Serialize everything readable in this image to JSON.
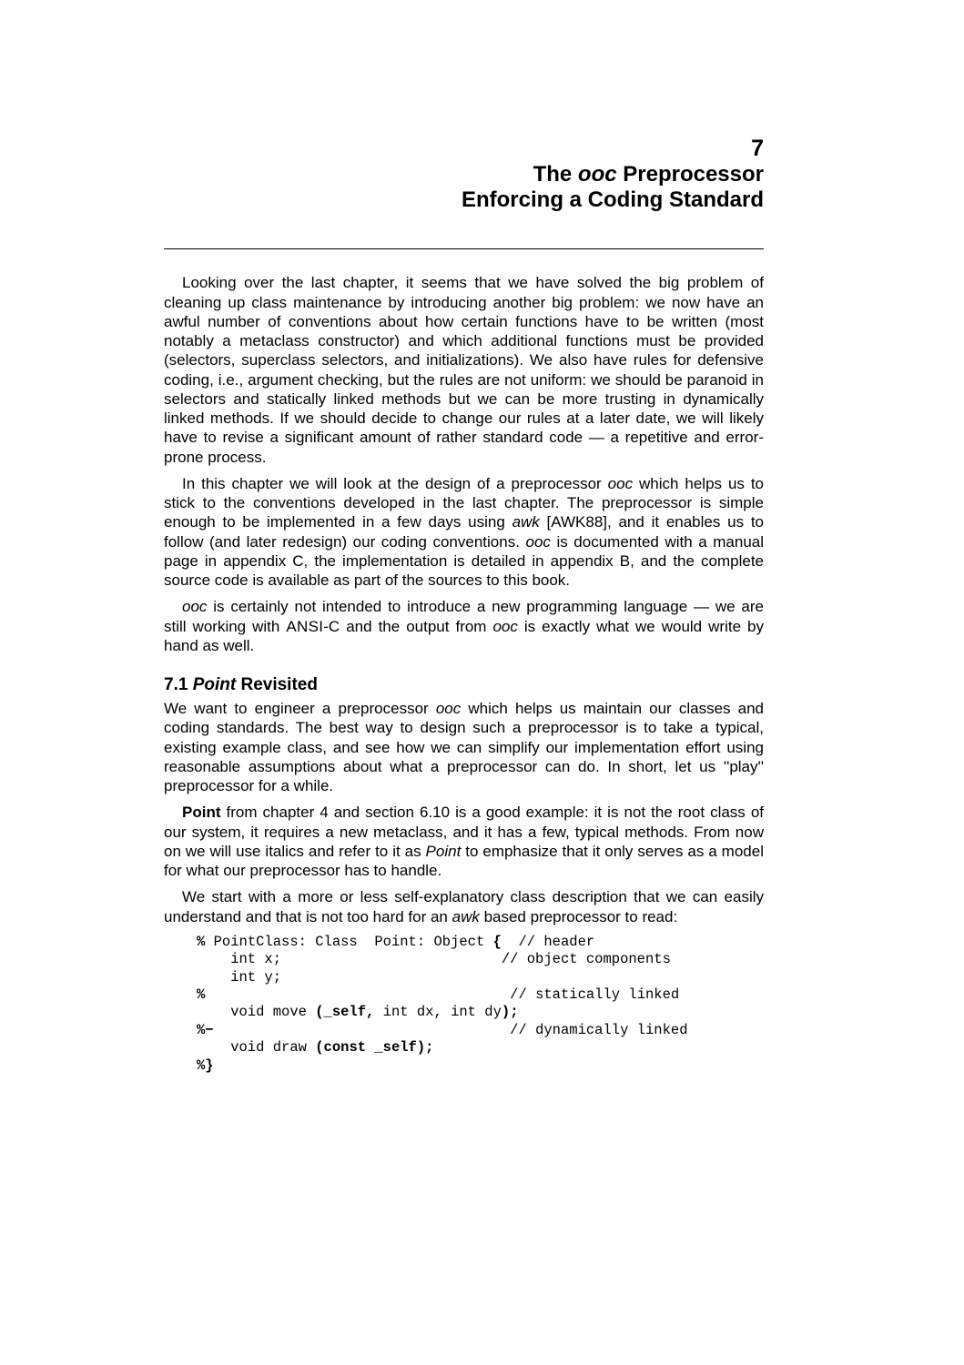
{
  "chapter": {
    "number": "7",
    "title_line1_pre": "The ",
    "title_line1_ooc": "ooc",
    "title_line1_post": " Preprocessor",
    "title_line2": "Enforcing a Coding Standard"
  },
  "para1": {
    "t1": "Looking over the last chapter, it seems that we have solved the big problem of cleaning up class maintenance by introducing another big problem: we now have an awful number of conventions about how certain functions have to be written (most notably a metaclass constructor) and which additional functions must be provided (selectors, superclass selectors, and initializations). We also have rules for defensive coding, i.e., argument checking, but the rules are not uniform: we should be paranoid in selectors and statically linked methods but we can be more trusting in dynamically linked methods. If we should decide to change our rules at a later date, we will likely have to revise a significant amount of rather standard code — a repetitive and error-prone process."
  },
  "para2": {
    "t1": "In this chapter we will look at the design of a preprocessor ",
    "ooc1": "ooc",
    "t2": " which helps us to stick to the conventions developed in the last chapter. The preprocessor is simple enough to be implemented in a few days using ",
    "awk": "awk",
    "t3": " [AWK88], and it enables us to follow (and later redesign) our coding conventions. ",
    "ooc2": "ooc",
    "t4": " is documented with a manual page in appendix C, the implementation is detailed in appendix B, and the complete source code is available as part of the sources to this book."
  },
  "para3": {
    "ooc1": "ooc",
    "t1": " is certainly not intended to introduce a new programming language — we are still working with ",
    "ansi": "ANSI",
    "t2": "-C and the output from ",
    "ooc2": "ooc",
    "t3": " is exactly what we would write by hand as well."
  },
  "section": {
    "num": "7.1 ",
    "pointword": "Point",
    "rest": " Revisited"
  },
  "para4": {
    "t1": "We want to engineer a preprocessor ",
    "ooc1": "ooc",
    "t2": " which helps us maintain our classes and coding standards. The best way to design such a preprocessor is to take a typical, existing example class, and see how we can simplify our implementation effort using reasonable assumptions about what a preprocessor can do. In short, let us ''play'' preprocessor for a while."
  },
  "para5": {
    "Point1": "Point",
    "t1": " from chapter 4 and section 6.10 is a good example: it is not the root class of our system, it requires a new metaclass, and it has a few, typical methods. From now on we will use italics and refer to it as ",
    "Point2": "Point",
    "t2": " to emphasize that it only serves as a model for what our preprocessor has to handle."
  },
  "para6": {
    "t1": "We start with a more or less self-explanatory class description that we can easily understand and that is not too hard for an ",
    "awk": "awk",
    "t2": " based preprocessor to read:"
  },
  "code": {
    "l1a": "% ",
    "l1b": "PointClass: Class  Point: Object ",
    "l1c": "{",
    "l1d": "  // header",
    "l2a": "    int x;                          // object components",
    "l3a": "    int y;",
    "l4a": "%",
    "l4b": "                                    // statically linked",
    "l5a": "    void move ",
    "l5b": "(_self,",
    "l5c": " int dx, int dy",
    "l5d": ");",
    "l6a": "%−",
    "l6b": "                                   // dynamically linked",
    "l7a": "    void draw ",
    "l7b": "(const _self);",
    "l8a": "%}"
  }
}
